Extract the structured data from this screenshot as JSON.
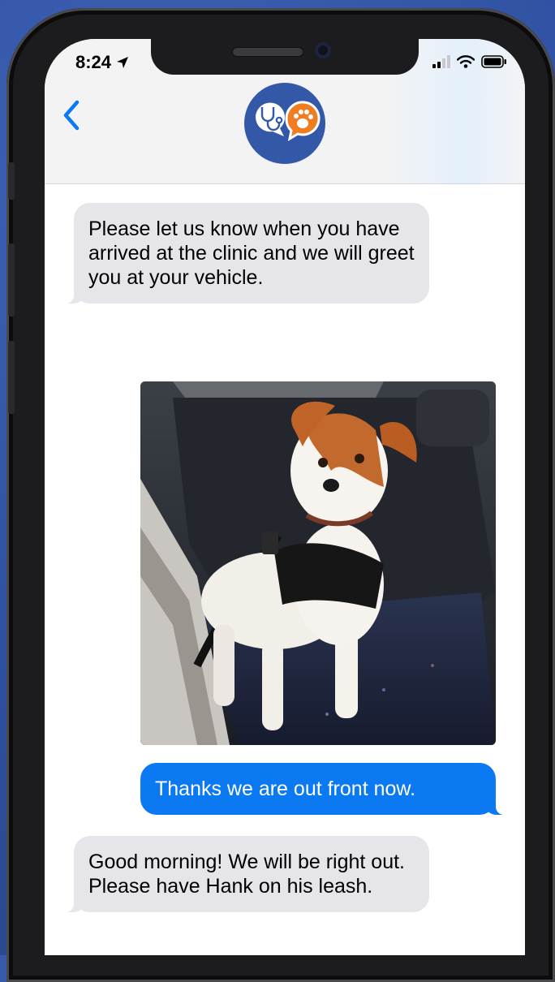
{
  "status": {
    "time": "8:24"
  },
  "contact": {
    "avatar_icon": "stethoscope-and-paw-logo",
    "brand_color": "#3458a8",
    "accent_color": "#f07d21"
  },
  "messages": [
    {
      "direction": "incoming",
      "text": "Please let us know when you have arrived at the clinic and we will greet you at your vehicle."
    },
    {
      "direction": "outgoing",
      "type": "photo",
      "image": "dog-in-car-seat-photo"
    },
    {
      "direction": "outgoing",
      "text": "Thanks we are out front now."
    },
    {
      "direction": "incoming",
      "text": "Good morning! We will be right out. Please have Hank on his leash."
    }
  ],
  "colors": {
    "outgoing_bubble": "#0b79f2",
    "incoming_bubble": "#e5e5ea",
    "back_chevron": "#0b79f2"
  }
}
